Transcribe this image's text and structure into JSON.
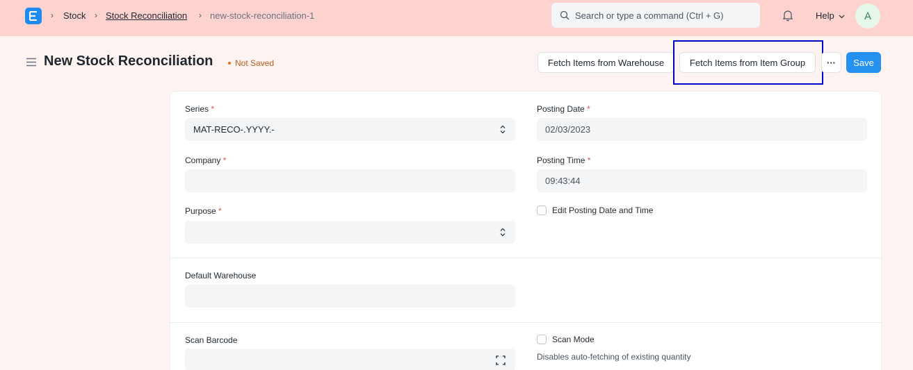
{
  "navbar": {
    "breadcrumbs": [
      "Stock",
      "Stock Reconciliation",
      "new-stock-reconciliation-1"
    ],
    "search_placeholder": "Search or type a command (Ctrl + G)",
    "help_label": "Help",
    "avatar_initial": "A"
  },
  "page": {
    "title": "New Stock Reconciliation",
    "status": "Not Saved",
    "buttons": {
      "fetch_warehouse": "Fetch Items from Warehouse",
      "fetch_item_group": "Fetch Items from Item Group",
      "more": "···",
      "save": "Save"
    }
  },
  "form": {
    "series": {
      "label": "Series",
      "required": "*",
      "value": "MAT-RECO-.YYYY.-"
    },
    "company": {
      "label": "Company",
      "required": "*",
      "value": ""
    },
    "purpose": {
      "label": "Purpose",
      "required": "*",
      "value": ""
    },
    "posting_date": {
      "label": "Posting Date",
      "required": "*",
      "value": "02/03/2023"
    },
    "posting_time": {
      "label": "Posting Time",
      "required": "*",
      "value": "09:43:44"
    },
    "edit_posting": {
      "label": "Edit Posting Date and Time"
    },
    "default_warehouse": {
      "label": "Default Warehouse",
      "value": ""
    },
    "scan_barcode": {
      "label": "Scan Barcode",
      "value": ""
    },
    "scan_mode": {
      "label": "Scan Mode",
      "description": "Disables auto-fetching of existing quantity"
    }
  },
  "colors": {
    "navbar_bg": "#fdd2cf",
    "page_bg": "#fdf3f1",
    "primary": "#2490ef",
    "highlight": "#0000cc",
    "status": "#c05c19"
  }
}
